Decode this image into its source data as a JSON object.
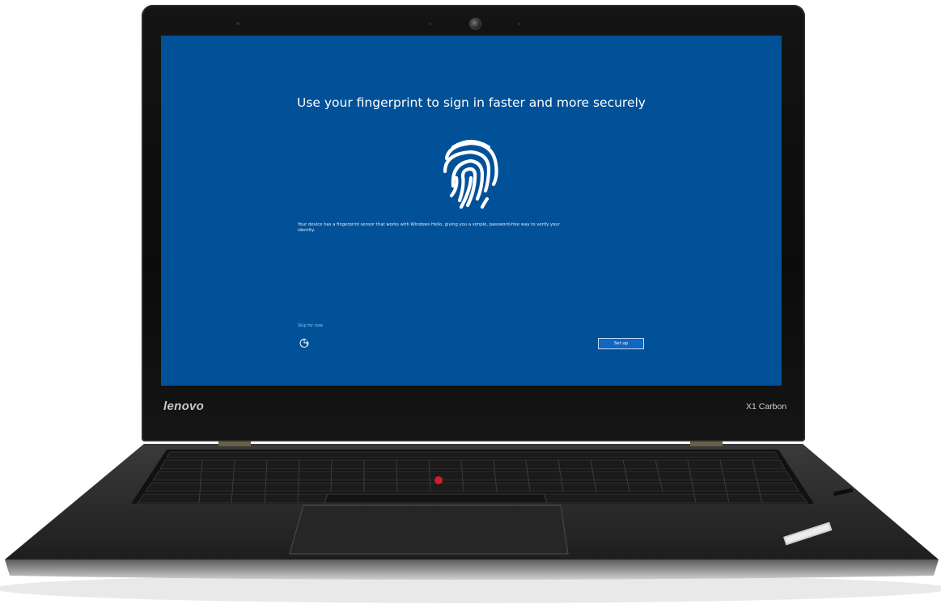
{
  "device": {
    "brand_logo": "lenovo",
    "model": "X1 Carbon"
  },
  "screen": {
    "title": "Use your fingerprint to sign in faster and more securely",
    "description": "Your device has a fingerprint sensor that works with Windows Hello, giving you a simple, password-free way to verify your identity.",
    "skip_label": "Skip for now",
    "setup_label": "Set up",
    "fingerprint_icon": "fingerprint-icon",
    "ease_of_access_icon": "ease-of-access-icon",
    "background_color": "#015198",
    "button_color": "#1066c2"
  }
}
